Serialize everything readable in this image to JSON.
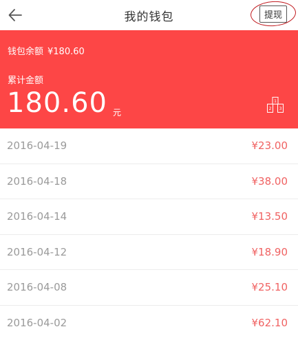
{
  "header": {
    "title": "我的钱包",
    "withdraw_label": "提现"
  },
  "banner": {
    "balance_label": "钱包余额",
    "balance_value": "¥180.60",
    "total_label": "累计金额",
    "total_value": "180.60",
    "total_unit": "元",
    "icon": "podium-icon",
    "podium_numbers": [
      "1",
      "2",
      "3"
    ]
  },
  "records": [
    {
      "date": "2016-04-19",
      "amount": "¥23.00"
    },
    {
      "date": "2016-04-18",
      "amount": "¥38.00"
    },
    {
      "date": "2016-04-14",
      "amount": "¥13.50"
    },
    {
      "date": "2016-04-12",
      "amount": "¥18.90"
    },
    {
      "date": "2016-04-08",
      "amount": "¥25.10"
    },
    {
      "date": "2016-04-02",
      "amount": "¥62.10"
    }
  ],
  "colors": {
    "banner_background": "#fd4646",
    "amount_text": "#f06262",
    "date_text": "#9a9a9a",
    "annotation_circle": "#c0171c"
  }
}
